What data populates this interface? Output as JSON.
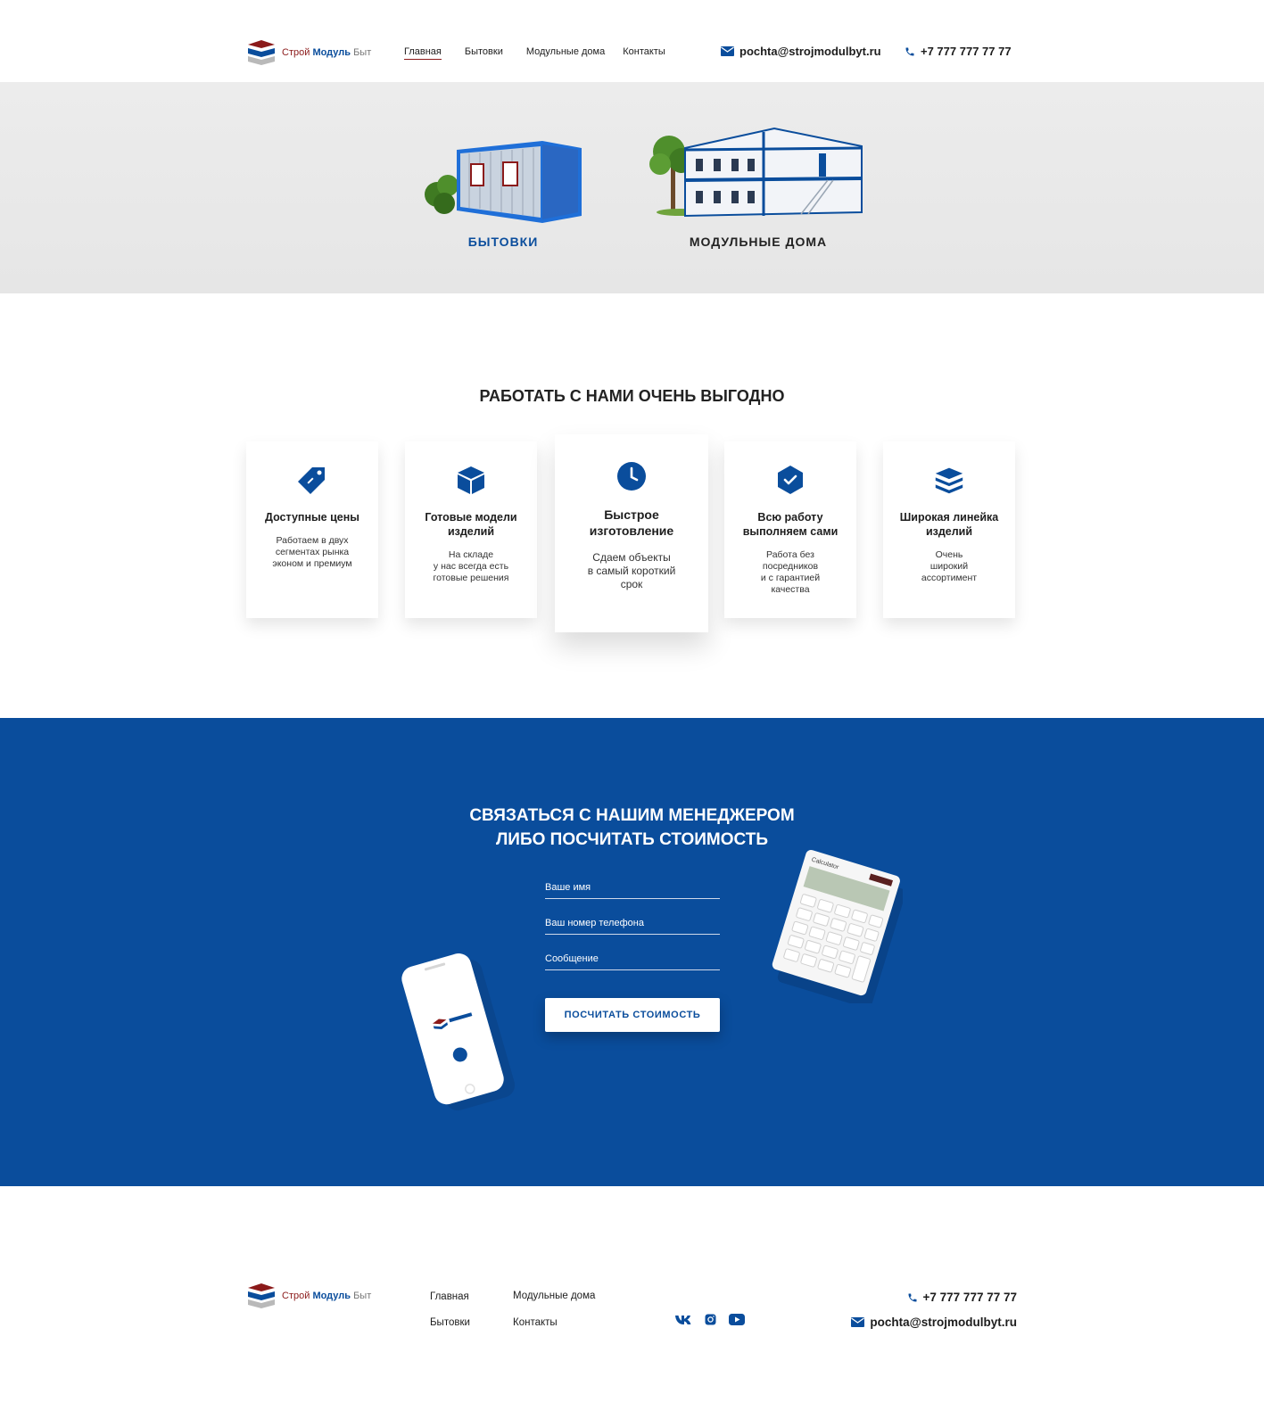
{
  "brand": {
    "part1": "Строй",
    "part2": "Модуль",
    "part3": "Быт"
  },
  "nav": {
    "items": [
      {
        "label": "Главная"
      },
      {
        "label": "Бытовки"
      },
      {
        "label": "Модульные дома"
      },
      {
        "label": "Контакты"
      }
    ]
  },
  "header": {
    "email": "pochta@strojmodulbyt.ru",
    "phone": "+7 777 777 77 77"
  },
  "hero": {
    "products": [
      {
        "label": "БЫТОВКИ"
      },
      {
        "label": "МОДУЛЬНЫЕ ДОМА"
      }
    ]
  },
  "benefits": {
    "title": "РАБОТАТЬ С НАМИ ОЧЕНЬ ВЫГОДНО",
    "cards": [
      {
        "icon": "price-tag-icon",
        "title": "Доступные цены",
        "text": "Работаем в двух\nсегментах рынка\nэконом и премиум"
      },
      {
        "icon": "box-icon",
        "title": "Готовые модели изделий",
        "text": "На складе\nу нас всегда есть\nготовые решения"
      },
      {
        "icon": "clock-icon",
        "title": "Быстрое изготовление",
        "text": "Сдаем объекты\nв самый короткий\nсрок"
      },
      {
        "icon": "shield-check-icon",
        "title": "Всю работу выполняем сами",
        "text": "Работа без\nпосредников\nи с гарантией\nкачества"
      },
      {
        "icon": "layers-icon",
        "title": "Широкая линейка изделий",
        "text": "Очень\nширокий\nассортимент"
      }
    ]
  },
  "contact_form": {
    "title_line1": "СВЯЗАТЬСЯ С НАШИМ МЕНЕДЖЕРОМ",
    "title_line2": "ЛИБО ПОСЧИТАТЬ СТОИМОСТЬ",
    "name_placeholder": "Ваше имя",
    "phone_placeholder": "Ваш номер телефона",
    "message_placeholder": "Сообщение",
    "submit_label": "ПОСЧИТАТЬ СТОИМОСТЬ",
    "calculator_brand": "Calculator"
  },
  "footer": {
    "nav": [
      "Главная",
      "Модульные дома",
      "Бытовки",
      "Контакты"
    ],
    "phone": "+7 777 777 77 77",
    "email": "pochta@strojmodulbyt.ru",
    "social": [
      "vk-icon",
      "instagram-icon",
      "youtube-icon"
    ]
  },
  "colors": {
    "primary": "#0a4d9c",
    "accent": "#8b1a1a",
    "text": "#1d1d1d",
    "hero_bg": "#e9e9e9"
  }
}
